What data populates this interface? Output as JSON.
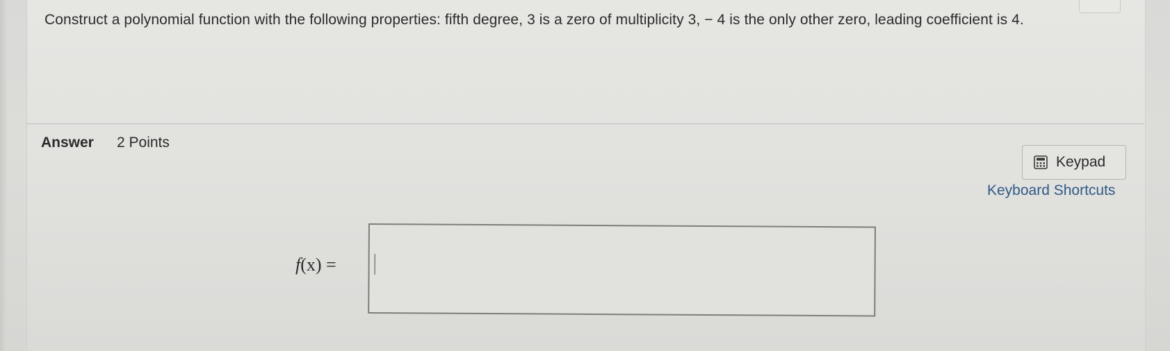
{
  "question": {
    "text": "Construct a polynomial function with the following properties: fifth degree, 3 is a zero of multiplicity 3, − 4 is the only other zero, leading coefficient is 4."
  },
  "answer": {
    "label": "Answer",
    "points": "2 Points"
  },
  "tools": {
    "keypad_label": "Keypad",
    "keypad_icon": "calculator-icon",
    "shortcuts_label": "Keyboard Shortcuts"
  },
  "input": {
    "fx_name": "f",
    "fx_arg": "(x) =",
    "value": ""
  }
}
